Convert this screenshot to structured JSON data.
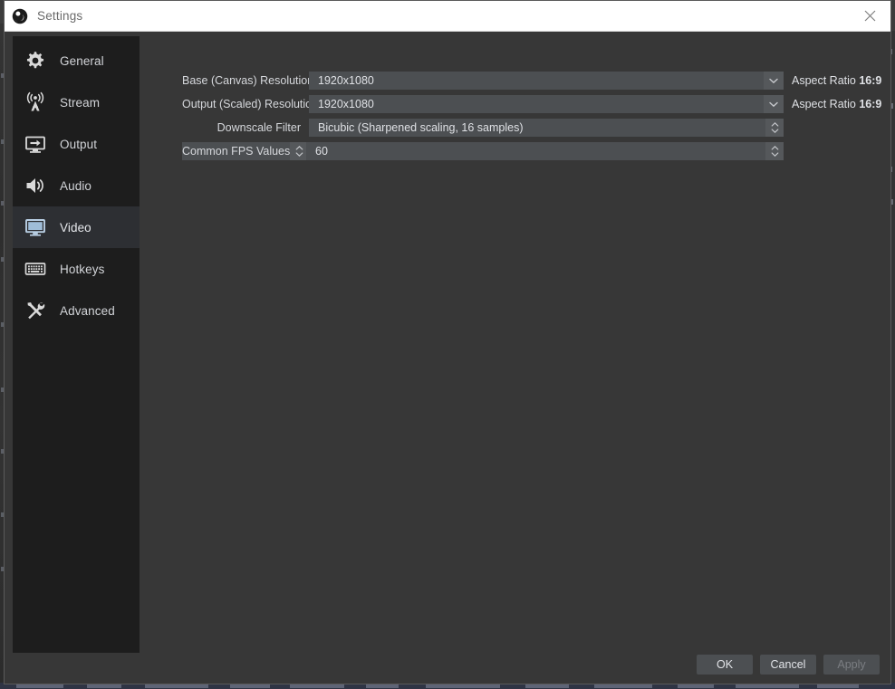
{
  "window": {
    "title": "Settings",
    "logo_icon": "obs-logo-icon",
    "close_icon": "close-icon"
  },
  "sidebar": {
    "items": [
      {
        "label": "General",
        "icon": "gear-icon",
        "selected": false
      },
      {
        "label": "Stream",
        "icon": "broadcast-icon",
        "selected": false
      },
      {
        "label": "Output",
        "icon": "monitor-arrow-icon",
        "selected": false
      },
      {
        "label": "Audio",
        "icon": "speaker-icon",
        "selected": false
      },
      {
        "label": "Video",
        "icon": "monitor-icon",
        "selected": true
      },
      {
        "label": "Hotkeys",
        "icon": "keyboard-icon",
        "selected": false
      },
      {
        "label": "Advanced",
        "icon": "tools-icon",
        "selected": false
      }
    ]
  },
  "video_settings": {
    "base_resolution": {
      "label": "Base (Canvas) Resolution",
      "value": "1920x1080",
      "dropdown_icon": "chevron-down-icon",
      "aspect_prefix": "Aspect Ratio",
      "aspect_value": "16:9"
    },
    "output_resolution": {
      "label": "Output (Scaled) Resolution",
      "value": "1920x1080",
      "dropdown_icon": "chevron-down-icon",
      "aspect_prefix": "Aspect Ratio",
      "aspect_value": "16:9"
    },
    "downscale_filter": {
      "label": "Downscale Filter",
      "value": "Bicubic (Sharpened scaling, 16 samples)",
      "spinner_icon": "spinner-updown-icon"
    },
    "fps": {
      "label": "Common FPS Values",
      "label_spinner_icon": "spinner-updown-icon",
      "value": "60",
      "spinner_icon": "spinner-updown-icon"
    }
  },
  "buttons": {
    "ok": "OK",
    "cancel": "Cancel",
    "apply": "Apply"
  },
  "colors": {
    "sidebar_bg": "#1d1d1d",
    "dialog_bg": "#373737",
    "field_bg": "#4c4f52",
    "titlebar_bg": "#ffffff",
    "selected_item_bg": "#2d2f33",
    "text": "#d6d8dc"
  }
}
